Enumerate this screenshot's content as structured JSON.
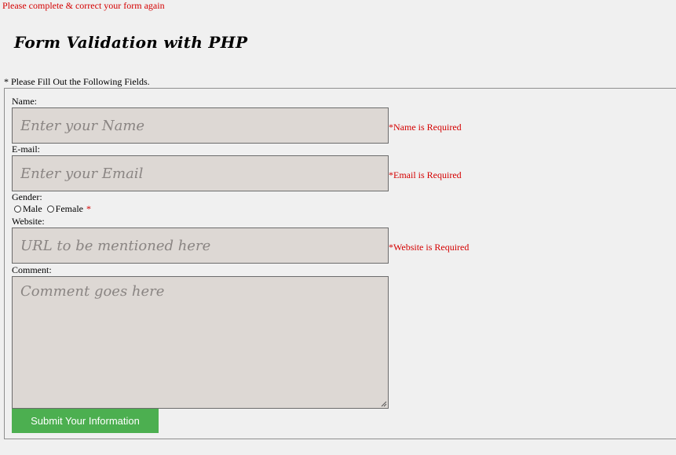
{
  "form_error": "Please complete & correct your form again",
  "title": "Form Validation with PHP",
  "instructions": "* Please Fill Out the Following Fields.",
  "fields": {
    "name": {
      "label": "Name:",
      "placeholder": "Enter your Name",
      "error": "*Name is Required"
    },
    "email": {
      "label": "E-mail:",
      "placeholder": "Enter your Email",
      "error": "*Email is Required"
    },
    "gender": {
      "label": "Gender:",
      "options": [
        "Male",
        "Female"
      ],
      "required_mark": "*"
    },
    "website": {
      "label": "Website:",
      "placeholder": "URL to be mentioned here",
      "error": "*Website is Required"
    },
    "comment": {
      "label": "Comment:",
      "placeholder": "Comment goes here"
    }
  },
  "submit_label": "Submit Your Information",
  "colors": {
    "error": "#d40000",
    "input_bg": "#ddd8d4",
    "submit_bg": "#4caf50"
  }
}
